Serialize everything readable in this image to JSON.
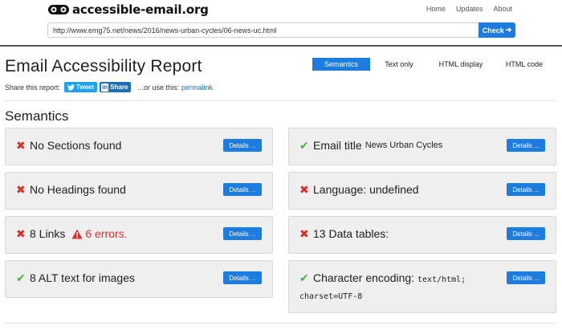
{
  "header": {
    "logo_text": "accessible-email.org",
    "nav": [
      "Home",
      "Updates",
      "About"
    ],
    "url_value": "http://www.emg75.net/news/2016/news-urban-cycles/06-news-uc.html",
    "check_label": "Check",
    "check_arrow": "➔"
  },
  "report": {
    "title": "Email Accessibility Report",
    "tabs": [
      "Semantics",
      "Text only",
      "HTML display",
      "HTML code"
    ],
    "active_tab": "Semantics",
    "share_label": "Share this report:",
    "tweet_label": "Tweet",
    "linkedin_mark": "in",
    "linkedin_label": "Share",
    "or_label": "...or use this:",
    "permalink_label": "permalink"
  },
  "semantics": {
    "title": "Semantics",
    "details_label": "Details ...",
    "left": [
      {
        "status": "fail",
        "icon": "✖",
        "label": "No Sections found"
      },
      {
        "status": "fail",
        "icon": "✖",
        "label": "No Headings found"
      },
      {
        "status": "fail",
        "icon": "✖",
        "label": "8 Links",
        "error": "6 errors."
      },
      {
        "status": "pass",
        "icon": "✔",
        "label": "8 ALT text for images"
      }
    ],
    "right": [
      {
        "status": "pass",
        "icon": "✔",
        "label": "Email title",
        "value": "News Urban Cycles"
      },
      {
        "status": "fail",
        "icon": "✖",
        "label": "Language: undefined"
      },
      {
        "status": "fail",
        "icon": "✖",
        "label": "13 Data tables:"
      },
      {
        "status": "pass",
        "icon": "✔",
        "label": "Character encoding:",
        "value": "text/html; charset=UTF-8"
      }
    ]
  },
  "colors": {
    "primary": "#1d7ce0",
    "fail": "#d9302c",
    "pass": "#4cae3c",
    "card_bg": "#efefef"
  }
}
